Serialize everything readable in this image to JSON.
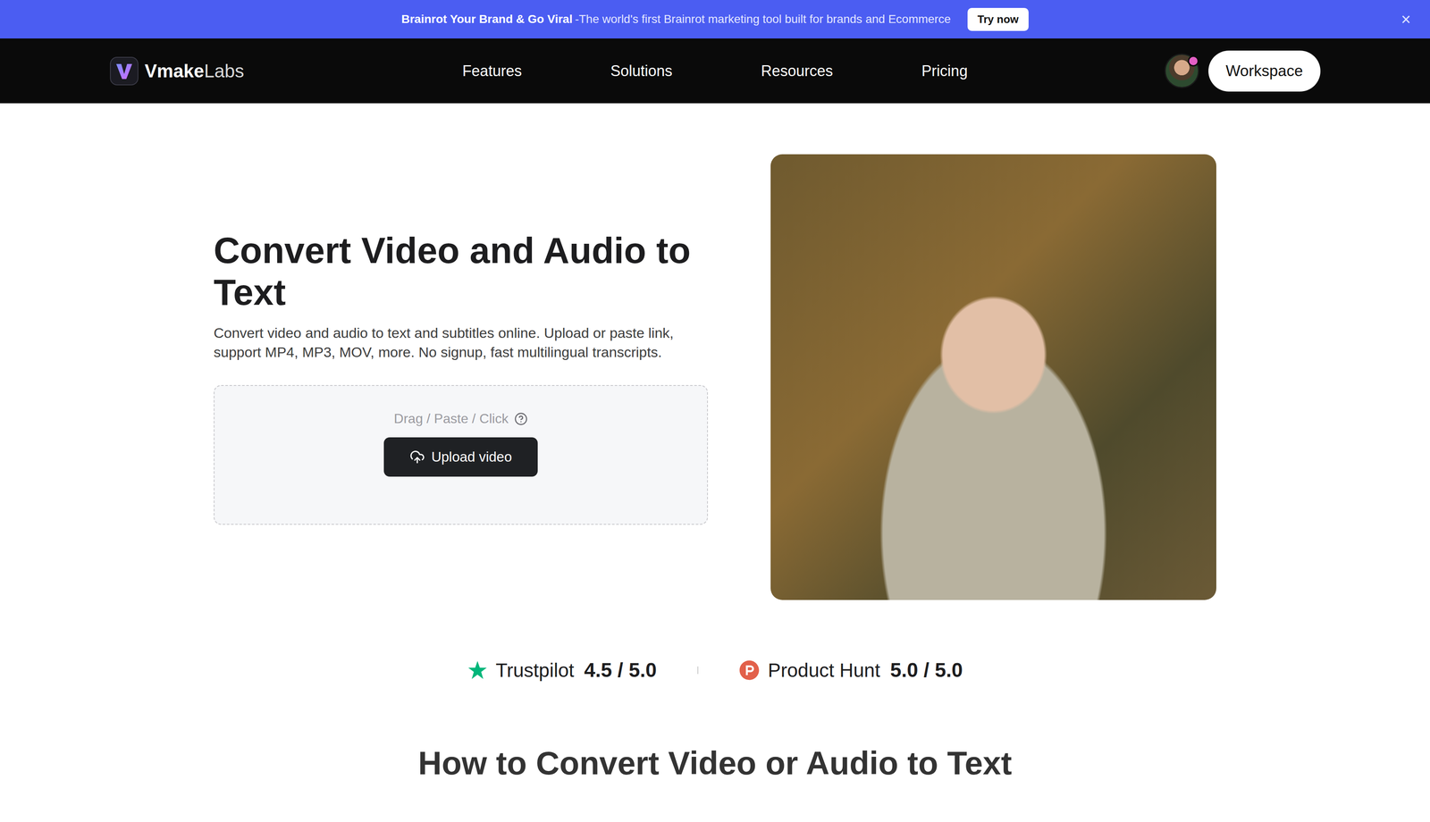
{
  "banner": {
    "headline": "Brainrot Your Brand & Go Viral",
    "text": "-The world's first Brainrot marketing tool built for brands and Ecommerce",
    "button": "Try now",
    "close": "×"
  },
  "nav": {
    "logo_bold": "Vmake",
    "logo_light": "Labs",
    "items": [
      "Features",
      "Solutions",
      "Resources",
      "Pricing"
    ],
    "workspace": "Workspace"
  },
  "hero": {
    "title": "Convert Video and Audio to Text",
    "subtitle": "Convert video and audio to text and subtitles online. Upload or paste link, support MP4, MP3, MOV, more. No signup, fast multilingual transcripts.",
    "upload": {
      "hint": "Drag / Paste / Click",
      "button": "Upload video"
    }
  },
  "ratings": [
    {
      "name": "Trustpilot",
      "score": "4.5 / 5.0",
      "kind": "trustpilot"
    },
    {
      "name": "Product Hunt",
      "score": "5.0 / 5.0",
      "kind": "producthunt"
    }
  ],
  "section": {
    "title": "How to Convert Video or Audio to Text"
  }
}
